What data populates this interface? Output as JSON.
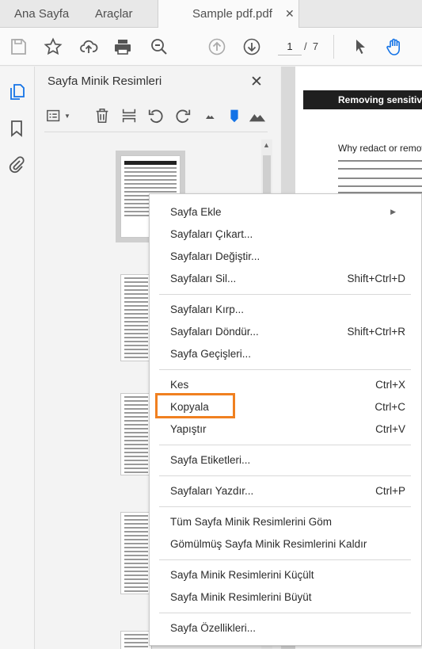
{
  "tabs": {
    "home": "Ana Sayfa",
    "tools": "Araçlar",
    "document": "Sample pdf.pdf"
  },
  "toolbar": {
    "current_page": "1",
    "page_separator": "/",
    "total_pages": "7"
  },
  "panel": {
    "title": "Sayfa Minik Resimleri"
  },
  "document": {
    "header": "Removing sensitive",
    "heading": "Why redact or remove"
  },
  "menu": {
    "items": [
      {
        "label": "Sayfa Ekle",
        "shortcut": "",
        "submenu": true
      },
      {
        "label": "Sayfaları Çıkart...",
        "shortcut": ""
      },
      {
        "label": "Sayfaları Değiştir...",
        "shortcut": ""
      },
      {
        "label": "Sayfaları Sil...",
        "shortcut": "Shift+Ctrl+D"
      },
      {
        "label": "Sayfaları Kırp...",
        "shortcut": ""
      },
      {
        "label": "Sayfaları Döndür...",
        "shortcut": "Shift+Ctrl+R"
      },
      {
        "label": "Sayfa Geçişleri...",
        "shortcut": ""
      },
      {
        "label": "Kes",
        "shortcut": "Ctrl+X"
      },
      {
        "label": "Kopyala",
        "shortcut": "Ctrl+C"
      },
      {
        "label": "Yapıştır",
        "shortcut": "Ctrl+V"
      },
      {
        "label": "Sayfa Etiketleri...",
        "shortcut": ""
      },
      {
        "label": "Sayfaları Yazdır...",
        "shortcut": "Ctrl+P"
      },
      {
        "label": "Tüm Sayfa Minik Resimlerini Göm",
        "shortcut": ""
      },
      {
        "label": "Gömülmüş Sayfa Minik Resimlerini Kaldır",
        "shortcut": ""
      },
      {
        "label": "Sayfa Minik Resimlerini Küçült",
        "shortcut": ""
      },
      {
        "label": "Sayfa Minik Resimlerini Büyüt",
        "shortcut": ""
      },
      {
        "label": "Sayfa Özellikleri...",
        "shortcut": ""
      }
    ],
    "highlighted_item": "Kopyala",
    "highlight_color": "#f08020"
  },
  "colors": {
    "accent_blue": "#1473e6"
  }
}
